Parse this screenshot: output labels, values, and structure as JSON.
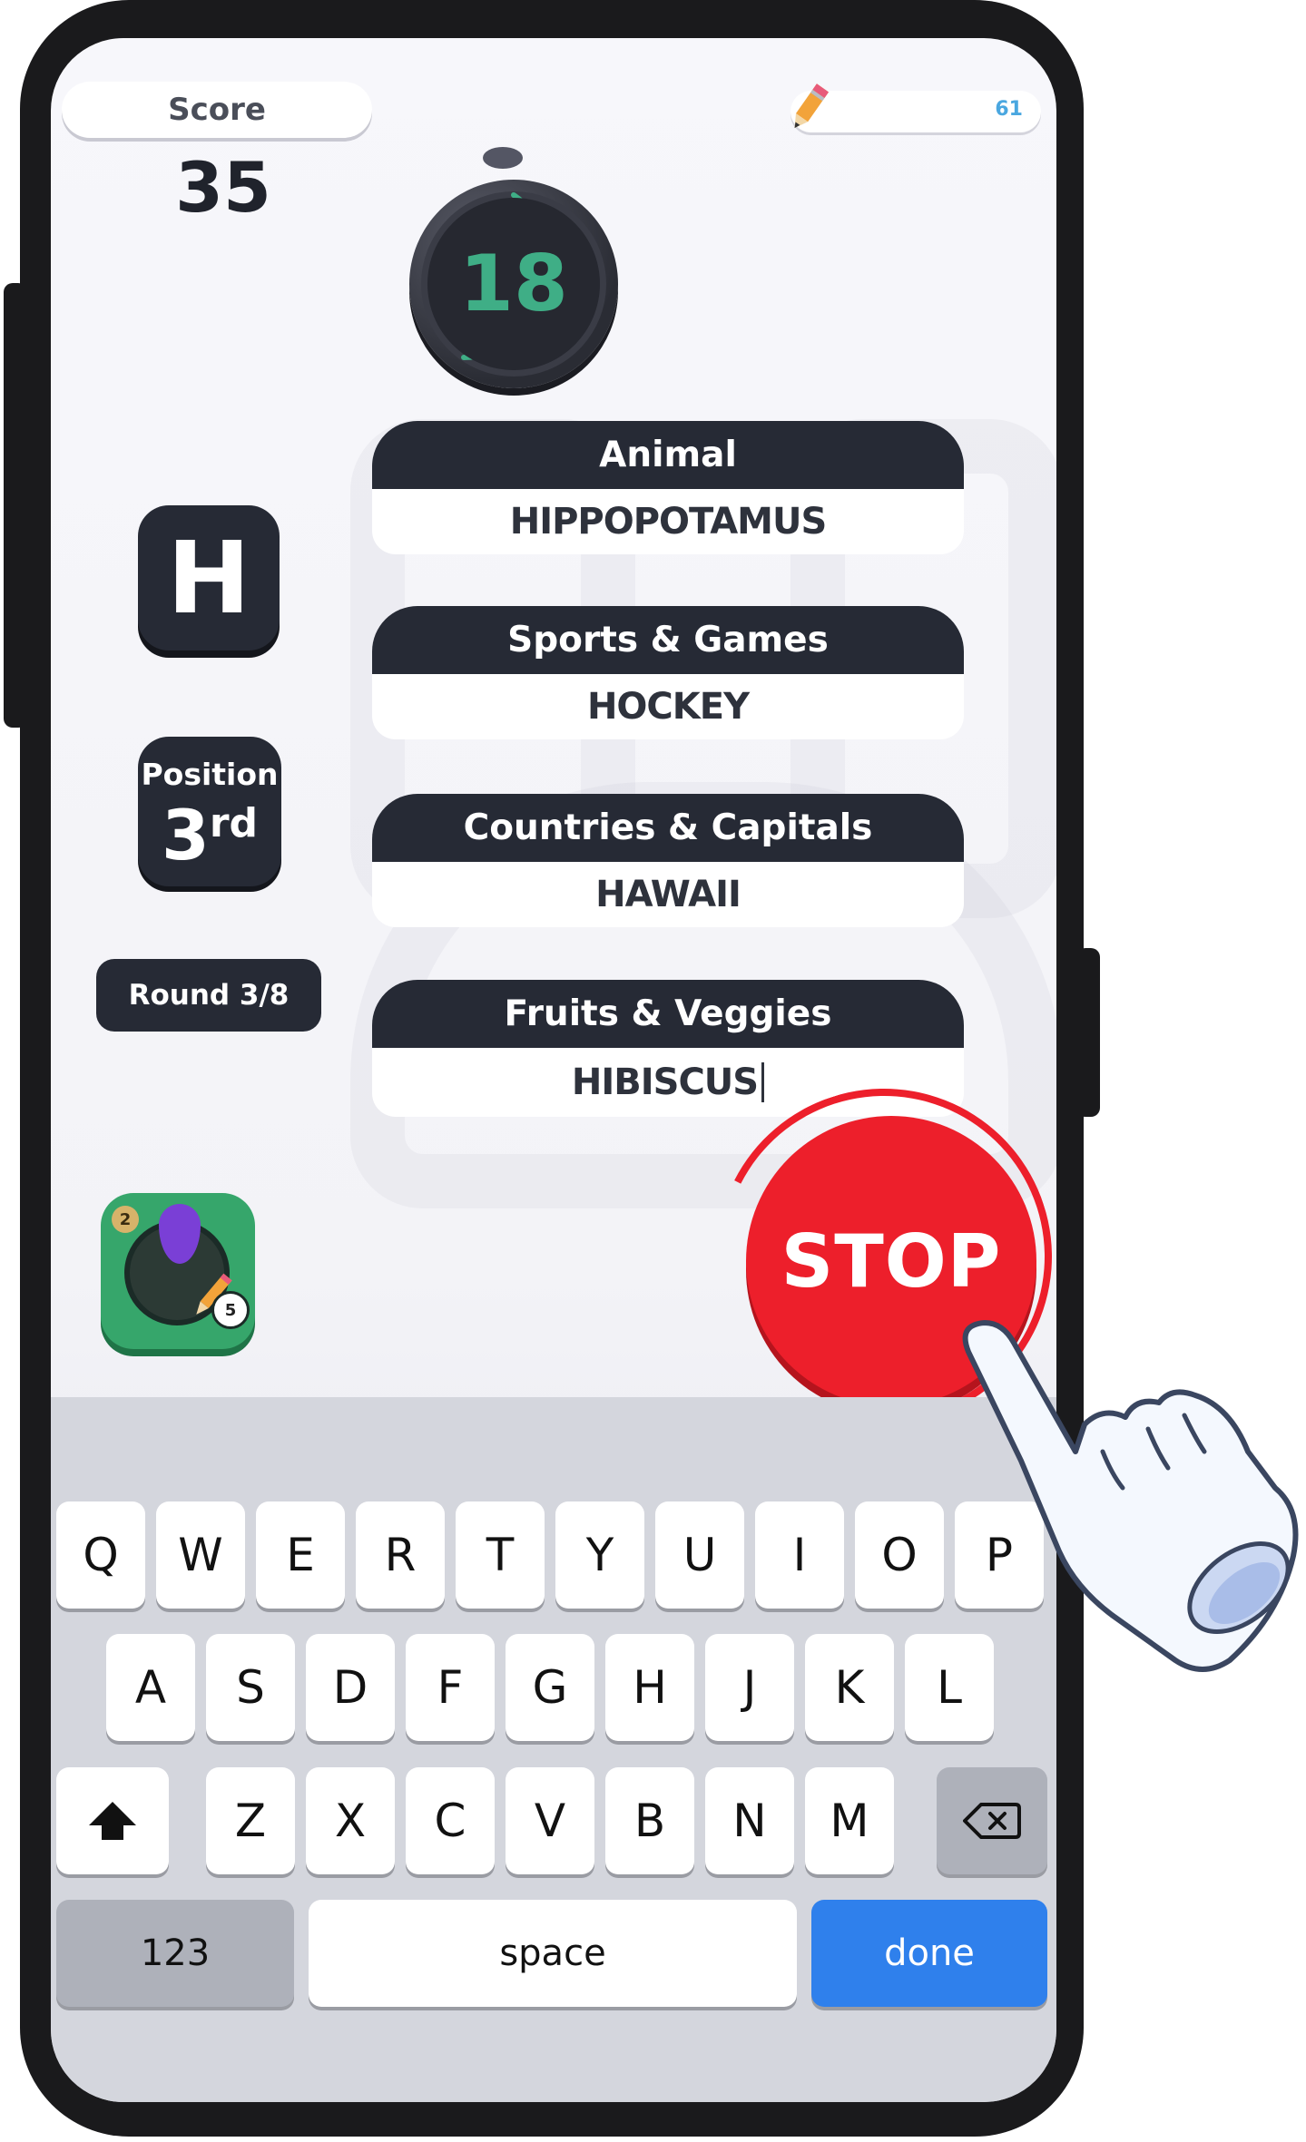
{
  "header": {
    "score_label": "Score",
    "score_value": "35",
    "pencils": "61"
  },
  "timer": {
    "seconds": "18"
  },
  "round": {
    "letter": "H",
    "position_label": "Position",
    "position_value": "3",
    "position_suffix": "rd",
    "round_label": "Round 3/8"
  },
  "categories": [
    {
      "title": "Animal",
      "answer": "HIPPOPOTAMUS"
    },
    {
      "title": "Sports & Games",
      "answer": "HOCKEY"
    },
    {
      "title": "Countries & Capitals",
      "answer": "HAWAII"
    },
    {
      "title": "Fruits & Veggies",
      "answer": "HIBISCUS"
    }
  ],
  "powerup": {
    "left_badge": "2",
    "right_badge": "5"
  },
  "stop_button": {
    "label": "STOP",
    "color": "#ed1f2b"
  },
  "keyboard": {
    "row1": [
      "Q",
      "W",
      "E",
      "R",
      "T",
      "Y",
      "U",
      "I",
      "O",
      "P"
    ],
    "row2": [
      "A",
      "S",
      "D",
      "F",
      "G",
      "H",
      "J",
      "K",
      "L"
    ],
    "row3": [
      "Z",
      "X",
      "C",
      "V",
      "B",
      "N",
      "M"
    ],
    "numbers_label": "123",
    "space_label": "space",
    "done_label": "done",
    "done_color": "#2f80ec"
  }
}
